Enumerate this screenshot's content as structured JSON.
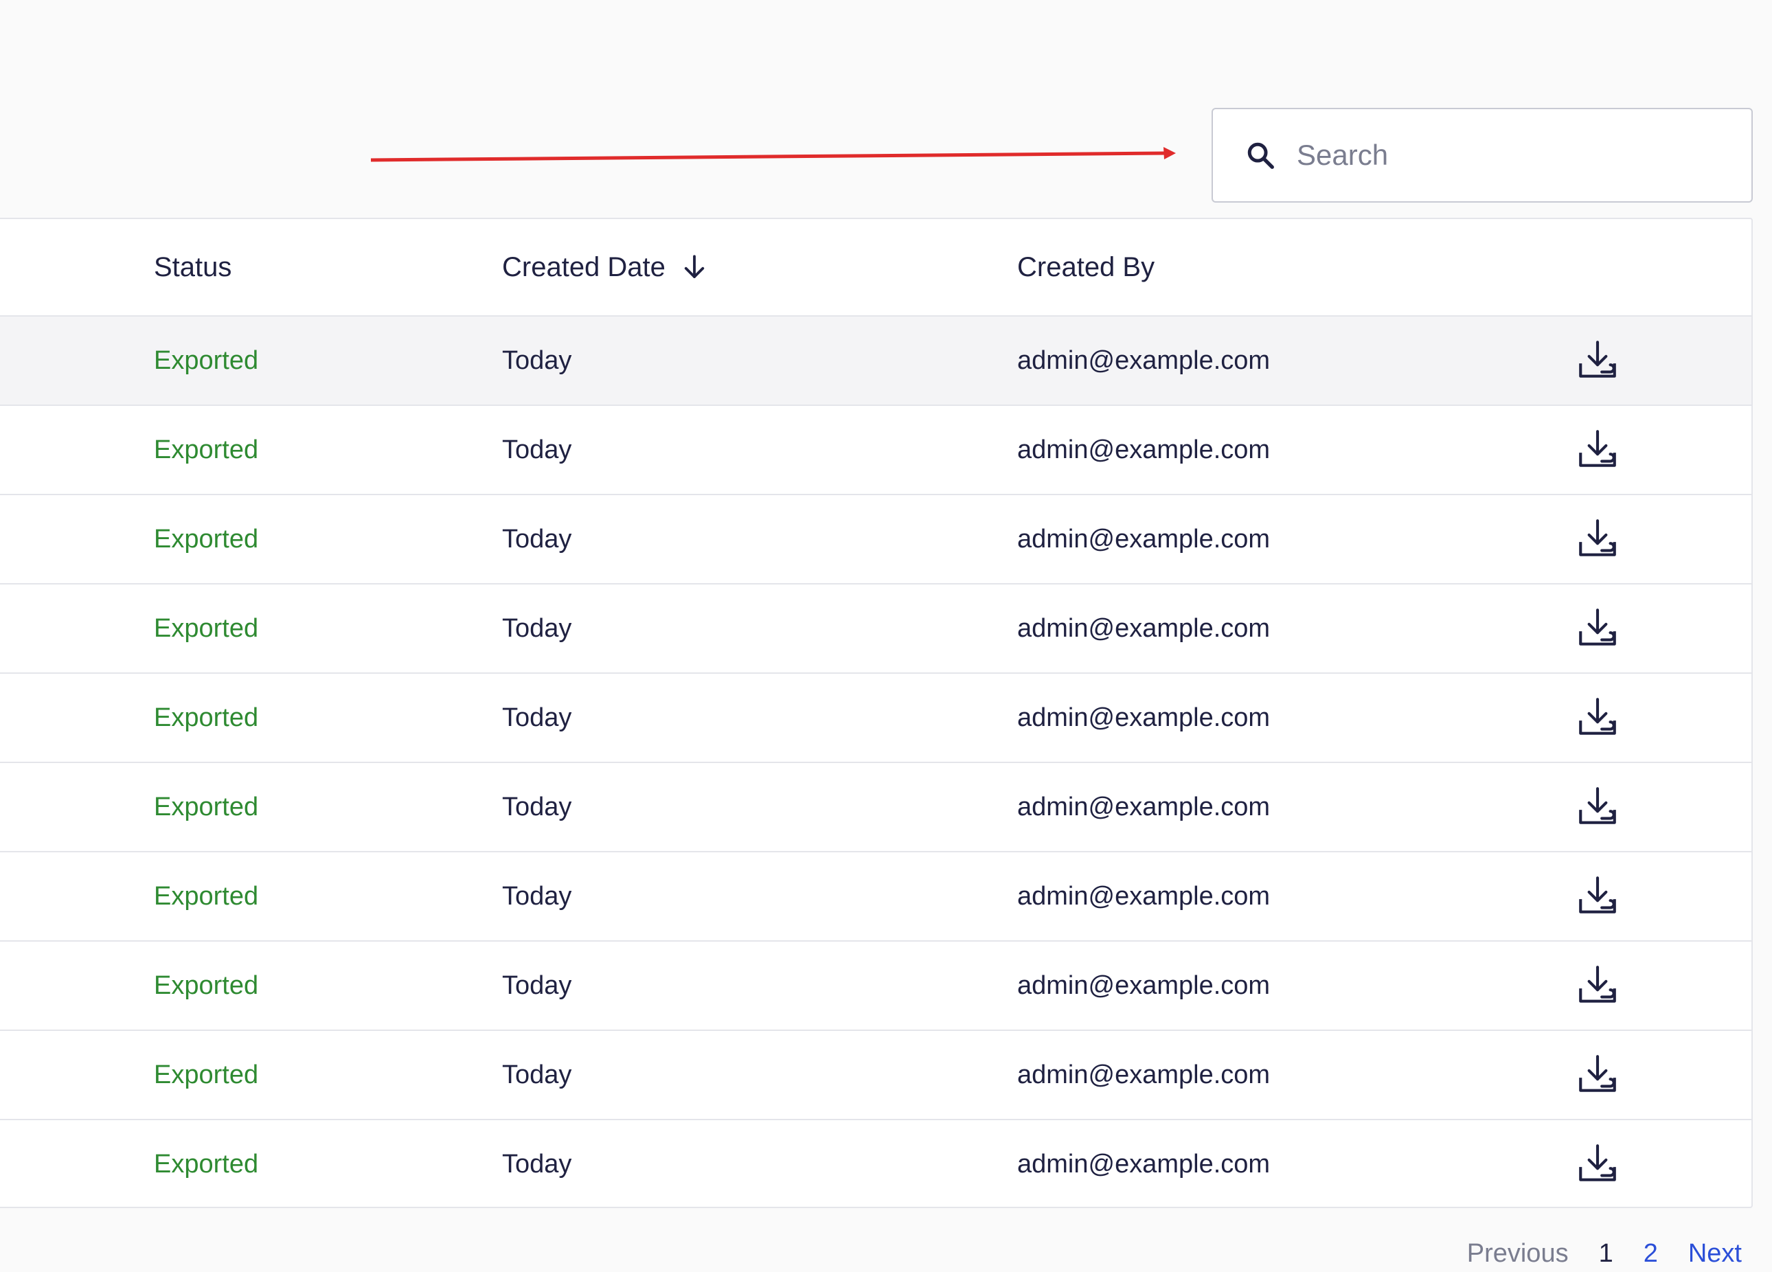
{
  "search": {
    "placeholder": "Search",
    "value": ""
  },
  "table": {
    "columns": {
      "status": "Status",
      "created_date": "Created Date",
      "created_by": "Created By"
    },
    "rows": [
      {
        "status": "Exported",
        "created_date": "Today",
        "created_by": "admin@example.com"
      },
      {
        "status": "Exported",
        "created_date": "Today",
        "created_by": "admin@example.com"
      },
      {
        "status": "Exported",
        "created_date": "Today",
        "created_by": "admin@example.com"
      },
      {
        "status": "Exported",
        "created_date": "Today",
        "created_by": "admin@example.com"
      },
      {
        "status": "Exported",
        "created_date": "Today",
        "created_by": "admin@example.com"
      },
      {
        "status": "Exported",
        "created_date": "Today",
        "created_by": "admin@example.com"
      },
      {
        "status": "Exported",
        "created_date": "Today",
        "created_by": "admin@example.com"
      },
      {
        "status": "Exported",
        "created_date": "Today",
        "created_by": "admin@example.com"
      },
      {
        "status": "Exported",
        "created_date": "Today",
        "created_by": "admin@example.com"
      },
      {
        "status": "Exported",
        "created_date": "Today",
        "created_by": "admin@example.com"
      }
    ],
    "sort_icon": "arrow-down-icon",
    "row_action_icon": "download-icon"
  },
  "pagination": {
    "previous": "Previous",
    "pages": [
      "1",
      "2"
    ],
    "current_page": "1",
    "next": "Next"
  },
  "colors": {
    "status_exported": "#2e8a31",
    "link": "#2b4fd8",
    "annotation_arrow": "#e02b2b",
    "text_primary": "#1f2141"
  }
}
